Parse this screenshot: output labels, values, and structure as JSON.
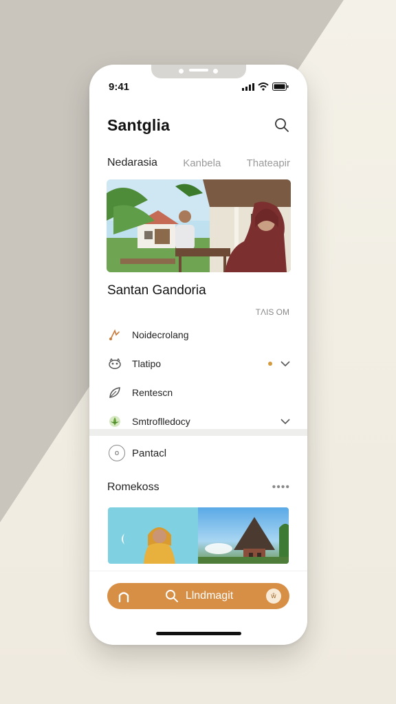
{
  "status": {
    "time": "9:41"
  },
  "header": {
    "title": "Santglia",
    "search_icon": "search-icon"
  },
  "tabs": [
    {
      "label": "Nedarasia",
      "active": true
    },
    {
      "label": "Kanbela",
      "active": false
    },
    {
      "label": "Thateapir",
      "active": false
    }
  ],
  "feature": {
    "title": "Santan Gandoria",
    "timestamp": "TΛIS OM"
  },
  "list": [
    {
      "label": "Noidecrolang",
      "icon": "route-icon",
      "has_dot": false,
      "has_chevron": false
    },
    {
      "label": "Tlatipo",
      "icon": "cat-icon",
      "has_dot": true,
      "has_chevron": true
    },
    {
      "label": "Rentescn",
      "icon": "leaf-icon",
      "has_dot": false,
      "has_chevron": false
    },
    {
      "label": "Smtroflledocy",
      "icon": "lotus-icon",
      "has_dot": false,
      "has_chevron": true
    }
  ],
  "pantacl": {
    "label": "Pantacl"
  },
  "recent": {
    "title": "Romekoss",
    "more": "••••"
  },
  "bottom_bar": {
    "search_label": "Llndmagit"
  },
  "colors": {
    "accent": "#d78e45",
    "dot": "#d49a3e"
  }
}
